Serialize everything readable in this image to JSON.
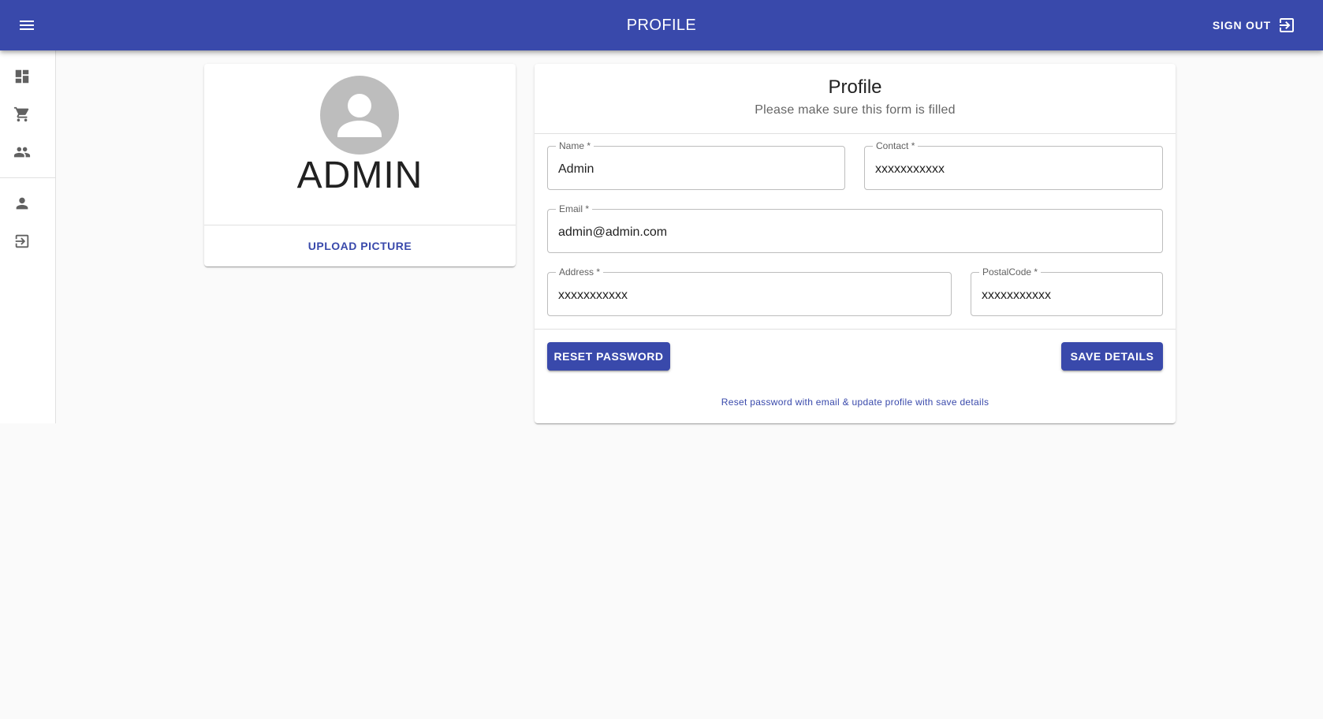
{
  "appbar": {
    "title": "PROFILE",
    "menu_icon": "menu-icon",
    "signout_label": "SIGN OUT",
    "signout_icon": "exit-to-app-icon",
    "color": "#3949ab"
  },
  "drawer": {
    "items": [
      {
        "name": "dashboard",
        "icon": "dashboard-icon"
      },
      {
        "name": "cart",
        "icon": "shopping-cart-icon"
      },
      {
        "name": "users",
        "icon": "people-icon"
      },
      {
        "name": "profile",
        "icon": "person-icon"
      },
      {
        "name": "logout",
        "icon": "exit-to-app-icon"
      }
    ]
  },
  "avatar_card": {
    "name": "ADMIN",
    "avatar_icon": "person-icon",
    "upload_label": "UPLOAD PICTURE"
  },
  "form": {
    "title": "Profile",
    "subtitle": "Please make sure this form is filled",
    "fields": {
      "name": {
        "label": "Name *",
        "value": "Admin"
      },
      "contact": {
        "label": "Contact *",
        "value": "xxxxxxxxxxx"
      },
      "email": {
        "label": "Email *",
        "value": "admin@admin.com"
      },
      "address": {
        "label": "Address *",
        "value": "xxxxxxxxxxx"
      },
      "postal_code": {
        "label": "PostalCode *",
        "value": "xxxxxxxxxxx"
      }
    },
    "reset_label": "RESET PASSWORD",
    "save_label": "SAVE DETAILS",
    "helper_text": "Reset password with email & update profile with save details"
  }
}
